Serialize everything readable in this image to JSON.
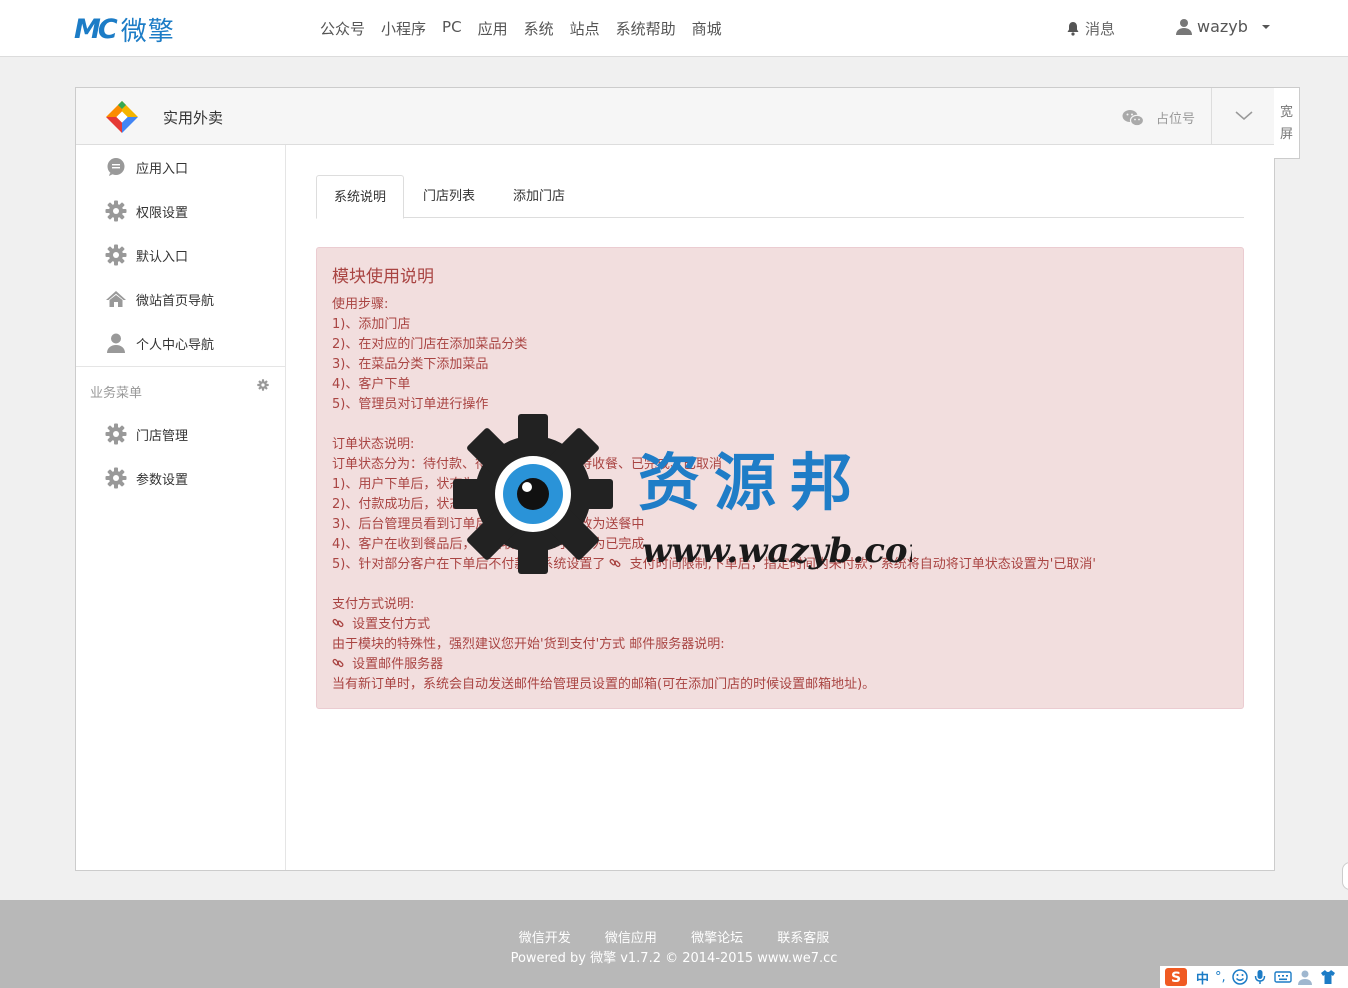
{
  "brand": {
    "mark": "MC",
    "name": "微擎"
  },
  "topnav": [
    "公众号",
    "小程序",
    "PC",
    "应用",
    "系统",
    "站点",
    "系统帮助",
    "商城"
  ],
  "header": {
    "messages": "消息",
    "username": "wazyb"
  },
  "app": {
    "title": "实用外卖",
    "placeholder": "占位号",
    "wide_label_1": "宽",
    "wide_label_2": "屏"
  },
  "sidebar": {
    "items": [
      {
        "label": "应用入口",
        "icon": "comment-icon"
      },
      {
        "label": "权限设置",
        "icon": "gear-icon"
      },
      {
        "label": "默认入口",
        "icon": "gear-icon"
      },
      {
        "label": "微站首页导航",
        "icon": "home-icon"
      },
      {
        "label": "个人中心导航",
        "icon": "user-icon"
      }
    ],
    "group_title": "业务菜单",
    "group_items": [
      {
        "label": "门店管理",
        "icon": "gear-icon"
      },
      {
        "label": "参数设置",
        "icon": "gear-icon"
      }
    ]
  },
  "tabs": [
    "系统说明",
    "门店列表",
    "添加门店"
  ],
  "notice": {
    "title": "模块使用说明",
    "steps_title": "使用步骤:",
    "steps": [
      "1)、添加门店",
      "2)、在对应的门店在添加菜品分类",
      "3)、在菜品分类下添加菜品",
      "4)、客户下单",
      "5)、管理员对订单进行操作"
    ],
    "status_title": "订单状态说明:",
    "status_lines": [
      "订单状态分为：待付款、待送餐、送餐中、待收餐、已完成、已取消",
      "1)、用户下单后，状态为待付款",
      "2)、付款成功后，状态为待送餐",
      "3)、后台管理员看到订单后，手动将状态修改为送餐中",
      "4)、客户在收到餐品后，确认收餐，此时状态为已完成"
    ],
    "status_line5_pre": "5)、针对部分客户在下单后不付款，系统设置了",
    "status_line5_post": "支付时间限制,下单后，指定时间内未付款，系统将自动将订单状态设置为'已取消'",
    "pay_title": "支付方式说明:",
    "pay_link": "设置支付方式",
    "pay_note": "由于模块的特殊性，强烈建议您开始'货到支付'方式 邮件服务器说明:",
    "mail_link": "设置邮件服务器",
    "mail_note": "当有新订单时，系统会自动发送邮件给管理员设置的邮箱(可在添加门店的时候设置邮箱地址)。"
  },
  "watermark": {
    "cn": "资源邦",
    "url": "www.wazyb.com"
  },
  "footer": {
    "links": [
      "微信开发",
      "微信应用",
      "微擎论坛",
      "联系客服"
    ],
    "copyright": "Powered by 微擎 v1.7.2 © 2014-2015 www.we7.cc"
  },
  "ime": {
    "lang": "中"
  }
}
